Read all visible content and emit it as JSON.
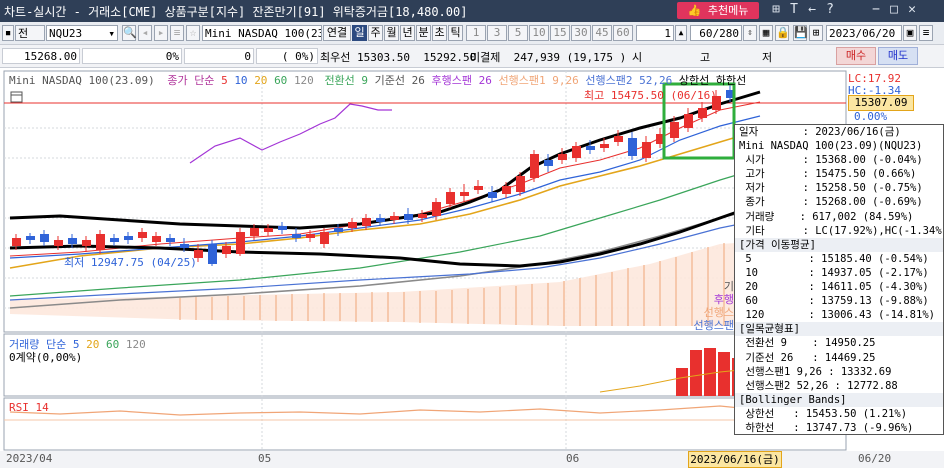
{
  "window": {
    "title": "차트-실시간 - 거래소[CME] 상품구분[지수] 잔존만기[91] 위탁증거금[18,480.00]",
    "menu_button": "추천메뉴"
  },
  "toolbar": {
    "mode_label": "전",
    "symbol": "NQU23",
    "product_name": "Mini NASDAQ 100(23.0",
    "link_label": "연결",
    "periods": [
      "일",
      "주",
      "월",
      "년",
      "분",
      "초",
      "틱"
    ],
    "active_period": "일",
    "intervals": [
      "1",
      "3",
      "5",
      "10",
      "15",
      "30",
      "45",
      "60"
    ],
    "count_value": "1",
    "page_count": "60/280",
    "date": "2023/06/20"
  },
  "quote": {
    "price": "15268.00",
    "change_percent": "0%",
    "volume_zero": "0",
    "volume_pct": "(    0%)",
    "best_offer_label": "최우선",
    "best_ask": "15303.50",
    "best_bid": "15292.50",
    "open_interest_label": "미결제",
    "open_interest": "247,939",
    "oi_change": "(19,175 )",
    "hlc_labels": [
      "시",
      "고",
      "저"
    ],
    "buy_label": "매수",
    "sell_label": "매도"
  },
  "legend": {
    "symbol_label": "Mini NASDAQ 100(23.09)",
    "ma_label": "종가 단순",
    "ma_periods": [
      "5",
      "10",
      "20",
      "60",
      "120"
    ],
    "ichimoku": [
      "전환선 9",
      "기준선 26",
      "후행스팬 26",
      "선행스팬1 9,26",
      "선행스팬2 52,26"
    ],
    "bb": [
      "상한선",
      "하한선"
    ]
  },
  "price_axis": {
    "lc_label": "LC:17.92",
    "hc_label": "HC:-1.34",
    "current_price": "15307.09",
    "current_pct": "0.00%"
  },
  "annotations": {
    "high_label": "최고 15475.50",
    "high_date": "(06/16)",
    "low_label": "최저 12947.75 (04/25)",
    "cloud_labels": [
      "기",
      "후행",
      "선행스",
      "선행스팬"
    ]
  },
  "volume_panel": {
    "title": "거래량 단순",
    "ma_periods": [
      "5",
      "20",
      "60",
      "120"
    ],
    "contract_label": "0계약(0,00%)"
  },
  "rsi_panel": {
    "title": "RSI 14"
  },
  "date_axis": {
    "labels": [
      "2023/04",
      "05",
      "06",
      "06/20"
    ],
    "cursor_label": "2023/06/16(금)"
  },
  "colors": {
    "up_candle": "#e8302e",
    "down_candle": "#2f63d8",
    "ma5": "#e8302e",
    "ma10": "#2f63d8",
    "ma20": "#e3a51a",
    "ma60": "#3aa55a",
    "ma120": "#8a8a8a",
    "price_line": "#000000",
    "highlight_box": "#2fae3c",
    "lagging_span": "#a335d6"
  },
  "info_panel": [
    {
      "text": "일자       : 2023/06/16(금)",
      "type": "row"
    },
    {
      "text": "Mini NASDAQ 100(23.09)(NQU23)",
      "type": "row"
    },
    {
      "text": " 시가      : 15368.00 (-0.04%)",
      "type": "row"
    },
    {
      "text": " 고가      : 15475.50 (0.66%)",
      "type": "row"
    },
    {
      "text": " 저가      : 15258.50 (-0.75%)",
      "type": "row"
    },
    {
      "text": " 종가      : 15268.00 (-0.69%)",
      "type": "row"
    },
    {
      "text": " 거래량    : 617,002 (84.59%)",
      "type": "row"
    },
    {
      "text": " 기타      : LC(17.92%),HC(-1.34%)",
      "type": "row"
    },
    {
      "text": "[가격 이동평균]",
      "type": "sec"
    },
    {
      "text": " 5         : 15185.40 (-0.54%)",
      "type": "row"
    },
    {
      "text": " 10        : 14937.05 (-2.17%)",
      "type": "row"
    },
    {
      "text": " 20        : 14611.05 (-4.30%)",
      "type": "row"
    },
    {
      "text": " 60        : 13759.13 (-9.88%)",
      "type": "row"
    },
    {
      "text": " 120       : 13006.43 (-14.81%)",
      "type": "row"
    },
    {
      "text": "[일목균형표]",
      "type": "sec"
    },
    {
      "text": " 전환선 9    : 14950.25",
      "type": "row"
    },
    {
      "text": " 기준선 26   : 14469.25",
      "type": "row"
    },
    {
      "text": " 선행스팬1 9,26 : 13332.69",
      "type": "row"
    },
    {
      "text": " 선행스팬2 52,26 : 12772.88",
      "type": "row"
    },
    {
      "text": "[Bollinger Bands]",
      "type": "sec"
    },
    {
      "text": " 상한선   : 15453.50 (1.21%)",
      "type": "row"
    },
    {
      "text": " 하한선   : 13747.73 (-9.96%)",
      "type": "row"
    }
  ]
}
